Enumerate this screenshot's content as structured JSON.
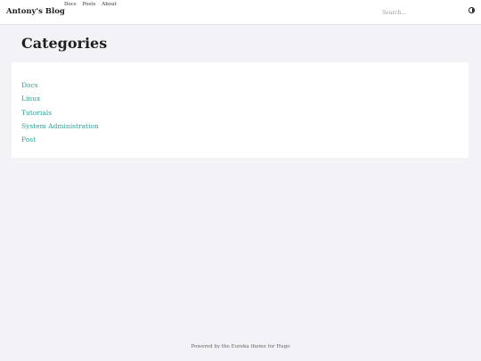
{
  "header": {
    "brand": "Antony's Blog",
    "nav": [
      "Docs",
      "Posts",
      "About"
    ],
    "search_placeholder": "Search...",
    "theme_toggle_icon": "half-circle-contrast-icon"
  },
  "main": {
    "title": "Categories",
    "categories": [
      "Docs",
      "Linux",
      "Tutorials",
      "System Administration",
      "Post"
    ]
  },
  "footer": {
    "text": "Powered by the Eureka theme for Hugo"
  },
  "colors": {
    "link": "#2aa198",
    "background": "#f3f2f7",
    "card": "#ffffff"
  }
}
